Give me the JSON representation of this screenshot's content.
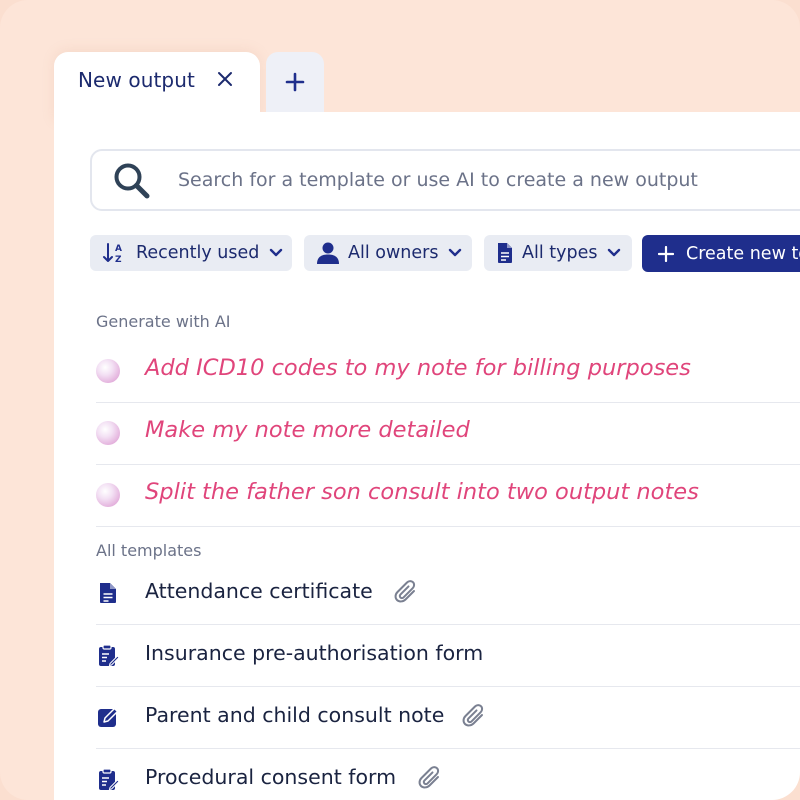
{
  "tabs": {
    "active_label": "New output",
    "close_symbol": "✕",
    "new_tab_symbol": "+"
  },
  "search": {
    "placeholder": "Search for a template or use AI to create a new output",
    "icon": "search-icon"
  },
  "filters": [
    {
      "label": "Recently used",
      "icon": "sort-az-icon"
    },
    {
      "label": "All owners",
      "icon": "user-icon"
    },
    {
      "label": "All types",
      "icon": "document-icon"
    }
  ],
  "create_button": {
    "label": "Create new te",
    "icon": "plus-icon"
  },
  "ai_section": {
    "title": "Generate with AI",
    "items": [
      "Add ICD10 codes to my note for billing purposes",
      "Make my note more detailed",
      "Split the father son consult into two output notes"
    ]
  },
  "templates_section": {
    "title": "All templates",
    "items": [
      {
        "label": "Attendance certificate",
        "icon": "document-icon",
        "attachment": true
      },
      {
        "label": "Insurance pre-authorisation form",
        "icon": "clipboard-edit-icon",
        "attachment": false
      },
      {
        "label": "Parent and child consult note",
        "icon": "edit-square-icon",
        "attachment": true
      },
      {
        "label": "Procedural consent form",
        "icon": "clipboard-edit-icon",
        "attachment": true
      }
    ]
  },
  "colors": {
    "background": "#fde5d8",
    "navy": "#1f2e8c",
    "ai_pink": "#e0457b",
    "chip_bg": "#e9ecf3"
  }
}
